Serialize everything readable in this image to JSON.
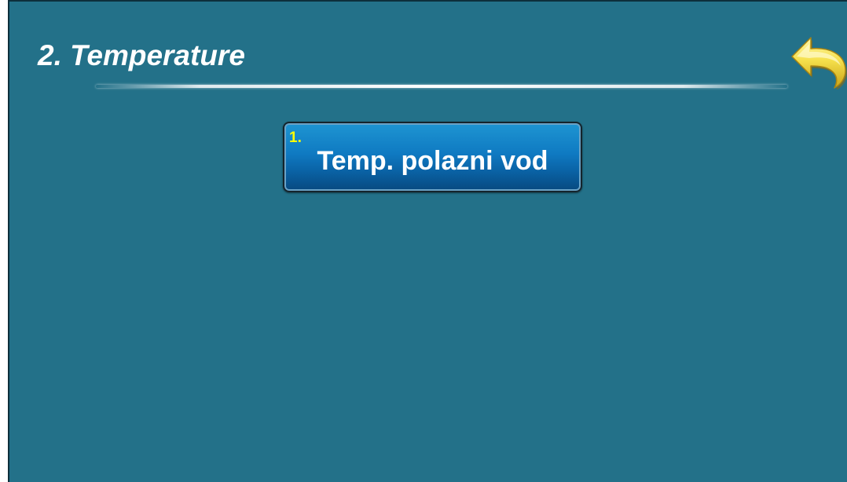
{
  "header": {
    "title": "2. Temperature",
    "back_icon": "back-arrow-icon"
  },
  "menu": {
    "items": [
      {
        "number": "1.",
        "label": "Temp. polazni vod"
      }
    ]
  },
  "colors": {
    "background": "#237189",
    "button": "#0f7ac2",
    "number_accent": "#ffff00",
    "back_icon": "#f2dd4a"
  }
}
